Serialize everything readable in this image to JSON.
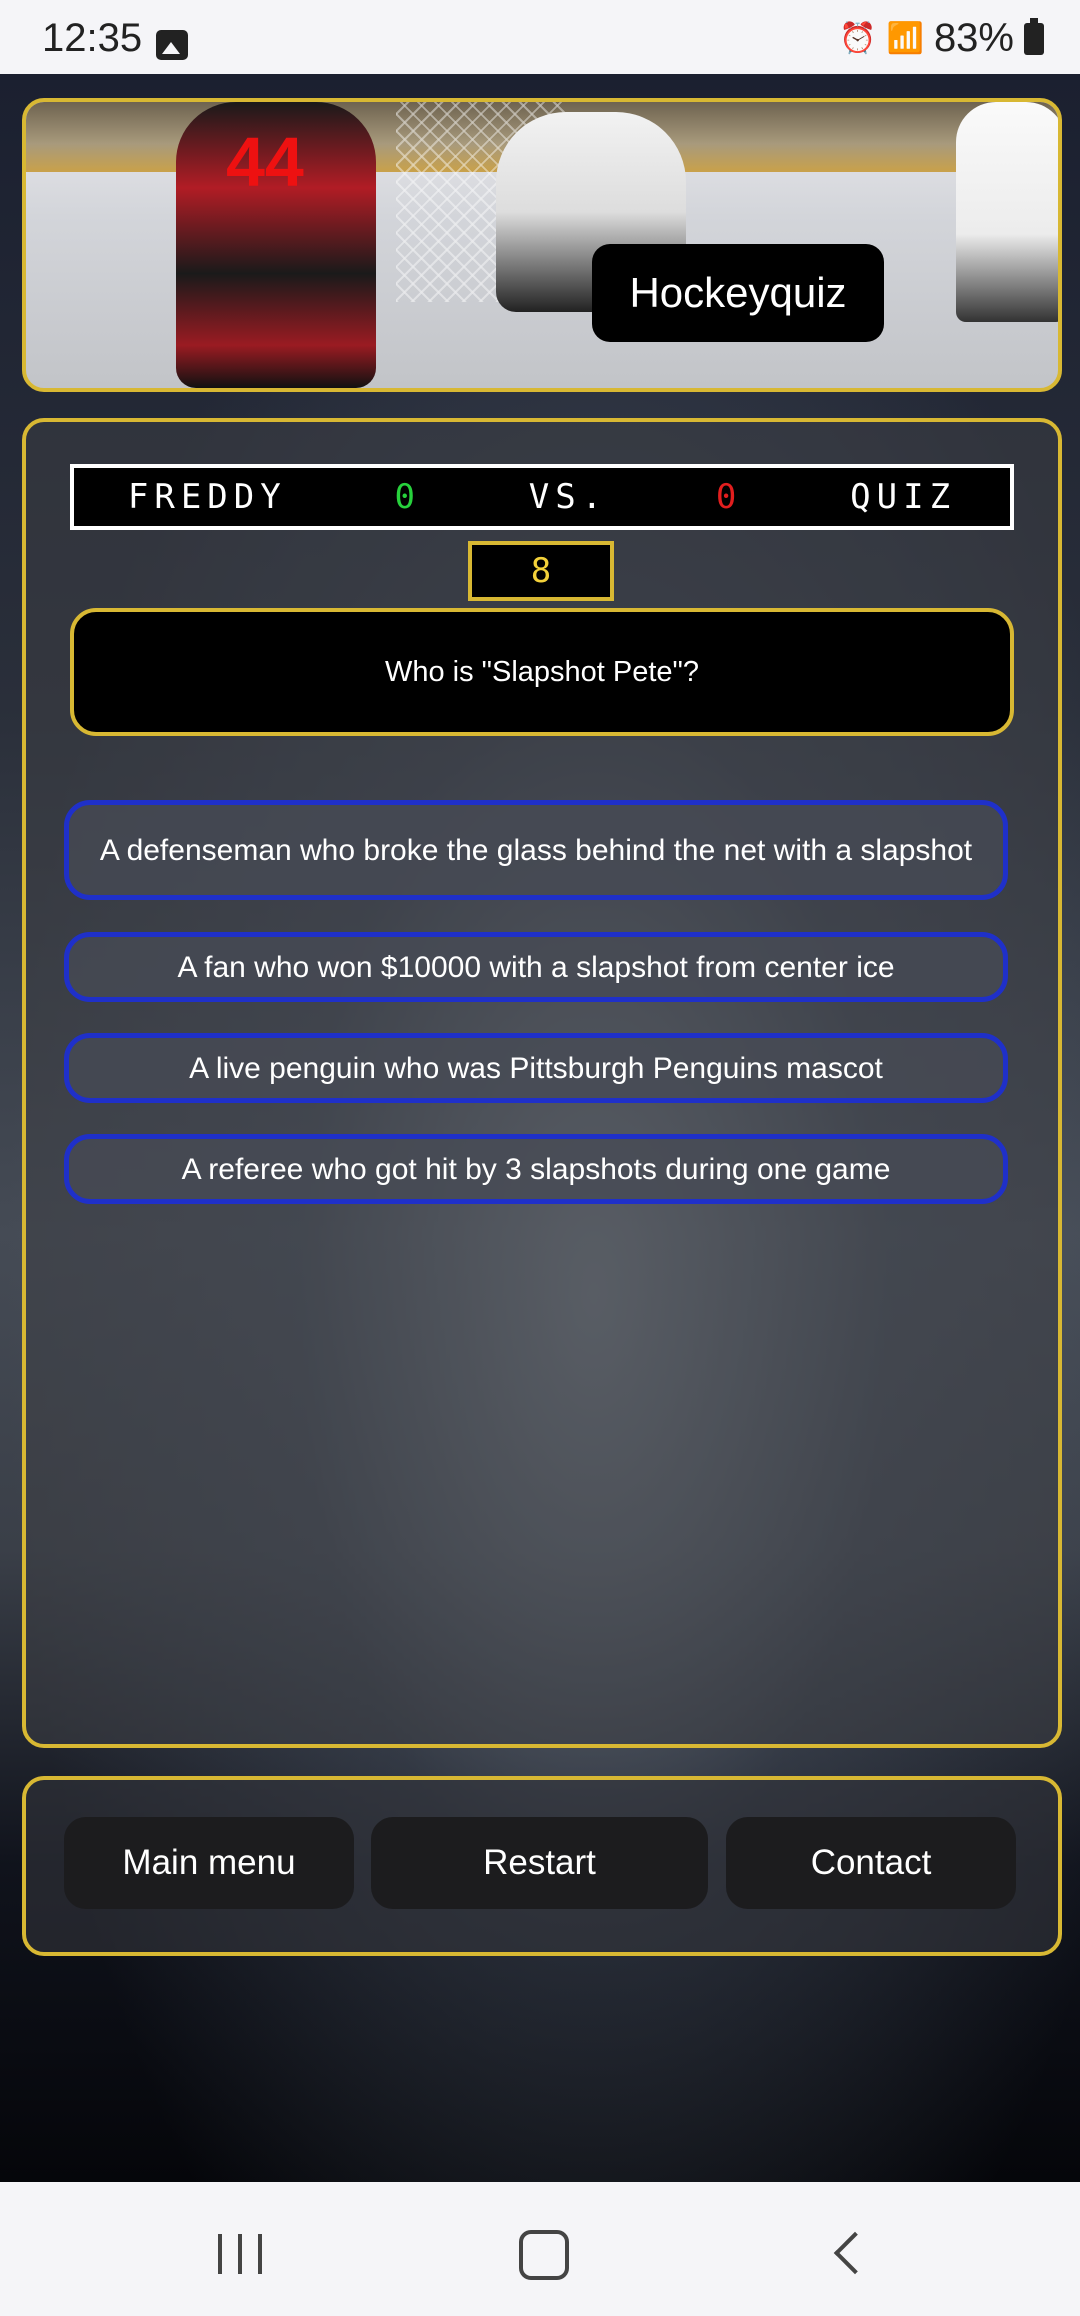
{
  "status_bar": {
    "time": "12:35",
    "battery": "83%"
  },
  "header": {
    "title": "Hockeyquiz",
    "jersey_number": "44"
  },
  "scoreboard": {
    "player_name": "FREDDY",
    "player_score": "0",
    "vs_label": "VS.",
    "quiz_score": "0",
    "quiz_name": "QUIZ",
    "timer": "8"
  },
  "question": {
    "text": "Who is \"Slapshot Pete\"?"
  },
  "answers": [
    {
      "text": "A defenseman who broke the glass behind the net with a slapshot"
    },
    {
      "text": "A fan who won $10000 with a slapshot from center ice"
    },
    {
      "text": "A live penguin who was Pittsburgh Penguins mascot"
    },
    {
      "text": "A referee who got hit by 3 slapshots during one game"
    }
  ],
  "nav": {
    "main_menu": "Main menu",
    "restart": "Restart",
    "contact": "Contact"
  },
  "colors": {
    "gold_border": "#d8b833",
    "answer_border": "#1f30c9",
    "player_score": "#27d13c",
    "quiz_score": "#e11e1e"
  }
}
